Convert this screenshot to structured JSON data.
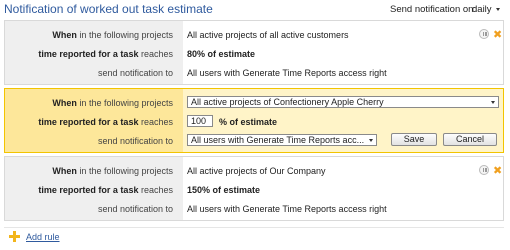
{
  "header": {
    "title": "Notification of worked out task estimate",
    "send_label": "Send notification on:",
    "send_value": "daily"
  },
  "labels": {
    "when_bold": "When",
    "when_rest": "in the following projects",
    "time_bold": "time reported for a task",
    "time_rest": "reaches",
    "send_to": "send notification to"
  },
  "rules": [
    {
      "projects": "All active projects of all active customers",
      "threshold": "80% of estimate",
      "recipients": "All users with Generate Time Reports access right",
      "icons": [
        "pause-icon",
        "delete-icon"
      ]
    },
    {
      "projects_select": "All active projects of Confectionery Apple Cherry",
      "threshold_input": "100",
      "threshold_suffix": "% of estimate",
      "recipients_select": "All users with Generate Time Reports acc...",
      "save_label": "Save",
      "cancel_label": "Cancel"
    },
    {
      "projects": "All active projects of Our Company",
      "threshold": "150% of estimate",
      "recipients": "All users with Generate Time Reports access right",
      "icons": [
        "pause-icon",
        "delete-icon"
      ]
    }
  ],
  "footer": {
    "add_rule_label": "Add rule"
  },
  "colors": {
    "title": "#2f5a9e",
    "active_left": "#fde79a",
    "active_right": "#fff4c8",
    "delete_icon": "#f0a020"
  }
}
